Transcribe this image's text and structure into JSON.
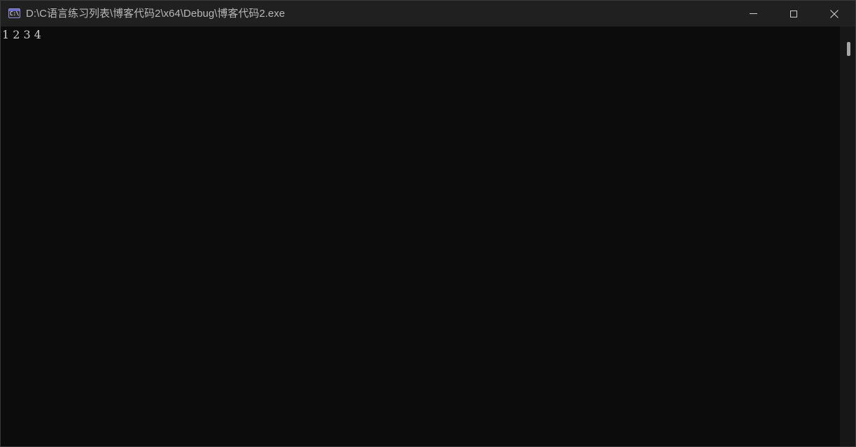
{
  "window": {
    "title": "D:\\C语言练习列表\\博客代码2\\x64\\Debug\\博客代码2.exe",
    "icon": "console-app-icon",
    "icon_glyph": "C:\\"
  },
  "caption_buttons": {
    "minimize_icon": "minimize-icon",
    "maximize_icon": "maximize-icon",
    "close_icon": "close-icon"
  },
  "console": {
    "output": "1 2 3 4",
    "background_color": "#0c0c0c",
    "text_color": "#cccccc"
  },
  "scrollbar": {
    "thumb_color": "#a6a6a6"
  }
}
